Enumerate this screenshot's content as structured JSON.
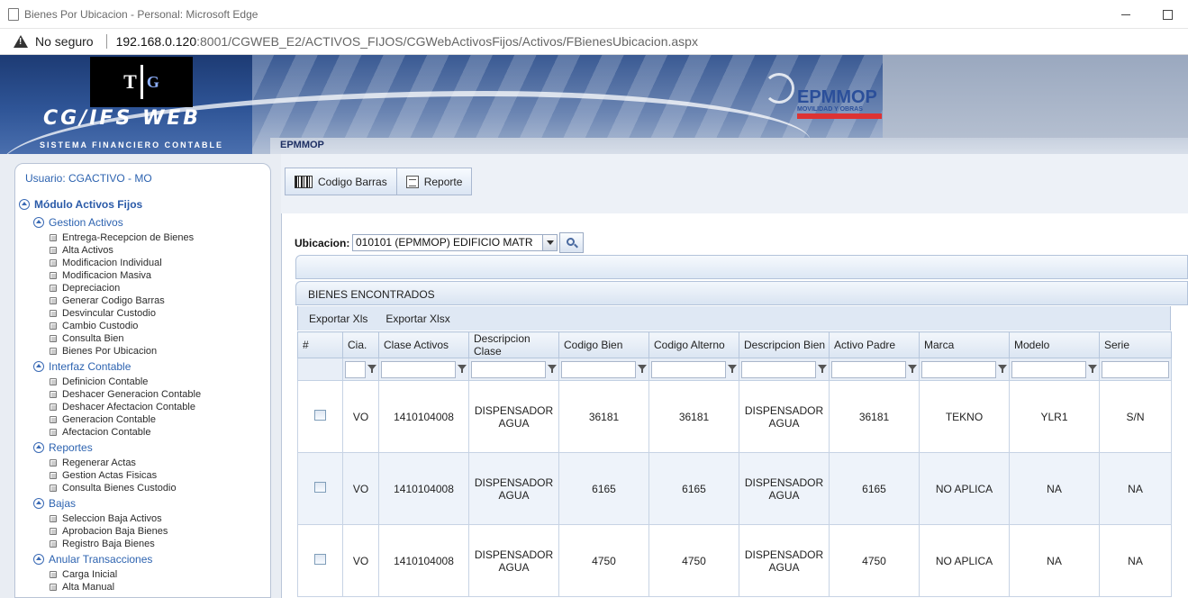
{
  "browser": {
    "title": "Bienes Por Ubicacion - Personal: Microsoft Edge",
    "not_secure": "No seguro",
    "url_host": "192.168.0.120",
    "url_rest": ":8001/CGWEB_E2/ACTIVOS_FIJOS/CGWebActivosFijos/Activos/FBienesUbicacion.aspx"
  },
  "header": {
    "logo_t": "T",
    "logo_g": "G",
    "app_name": "CG/IFS WEB",
    "app_sub": "SISTEMA FINANCIERO CONTABLE",
    "company_name": "EPMMOP",
    "company_tag": "MOVILIDAD Y OBRAS",
    "company_tab": "EPMMOP"
  },
  "sidebar": {
    "user": "Usuario: CGACTIVO - MO",
    "module": "Módulo Activos Fijos",
    "groups": [
      {
        "label": "Gestion Activos",
        "items": [
          "Entrega-Recepcion de Bienes",
          "Alta Activos",
          "Modificacion Individual",
          "Modificacion Masiva",
          "Depreciacion",
          "Generar Codigo Barras",
          "Desvincular Custodio",
          "Cambio Custodio",
          "Consulta Bien",
          "Bienes Por Ubicacion"
        ]
      },
      {
        "label": "Interfaz Contable",
        "items": [
          "Definicion Contable",
          "Deshacer Generacion Contable",
          "Deshacer Afectacion Contable",
          "Generacion Contable",
          "Afectacion Contable"
        ]
      },
      {
        "label": "Reportes",
        "items": [
          "Regenerar Actas",
          "Gestion Actas Fisicas",
          "Consulta Bienes Custodio"
        ]
      },
      {
        "label": "Bajas",
        "items": [
          "Seleccion Baja Activos",
          "Aprobacion Baja Bienes",
          "Registro Baja Bienes"
        ]
      },
      {
        "label": "Anular Transacciones",
        "items": [
          "Carga Inicial",
          "Alta Manual"
        ]
      }
    ]
  },
  "toolbar": {
    "barcode_label": "Codigo Barras",
    "report_label": "Reporte"
  },
  "filter": {
    "label": "Ubicacion:",
    "selected": "010101 (EPMMOP) EDIFICIO MATR"
  },
  "grid": {
    "caption": "BIENES ENCONTRADOS",
    "export_xls": "Exportar Xls",
    "export_xlsx": "Exportar Xlsx",
    "columns": [
      "#",
      "Cia.",
      "Clase Activos",
      "Descripcion Clase",
      "Codigo Bien",
      "Codigo Alterno",
      "Descripcion Bien",
      "Activo Padre",
      "Marca",
      "Modelo",
      "Serie"
    ],
    "rows": [
      {
        "cia": "VO",
        "clase": "1410104008",
        "desc_clase": "DISPENSADOR AGUA",
        "codigo": "36181",
        "alterno": "36181",
        "desc_bien": "DISPENSADOR AGUA",
        "padre": "36181",
        "marca": "TEKNO",
        "modelo": "YLR1",
        "serie": "S/N"
      },
      {
        "cia": "VO",
        "clase": "1410104008",
        "desc_clase": "DISPENSADOR AGUA",
        "codigo": "6165",
        "alterno": "6165",
        "desc_bien": "DISPENSADOR AGUA",
        "padre": "6165",
        "marca": "NO APLICA",
        "modelo": "NA",
        "serie": "NA"
      },
      {
        "cia": "VO",
        "clase": "1410104008",
        "desc_clase": "DISPENSADOR AGUA",
        "codigo": "4750",
        "alterno": "4750",
        "desc_bien": "DISPENSADOR AGUA",
        "padre": "4750",
        "marca": "NO APLICA",
        "modelo": "NA",
        "serie": "NA"
      }
    ]
  }
}
